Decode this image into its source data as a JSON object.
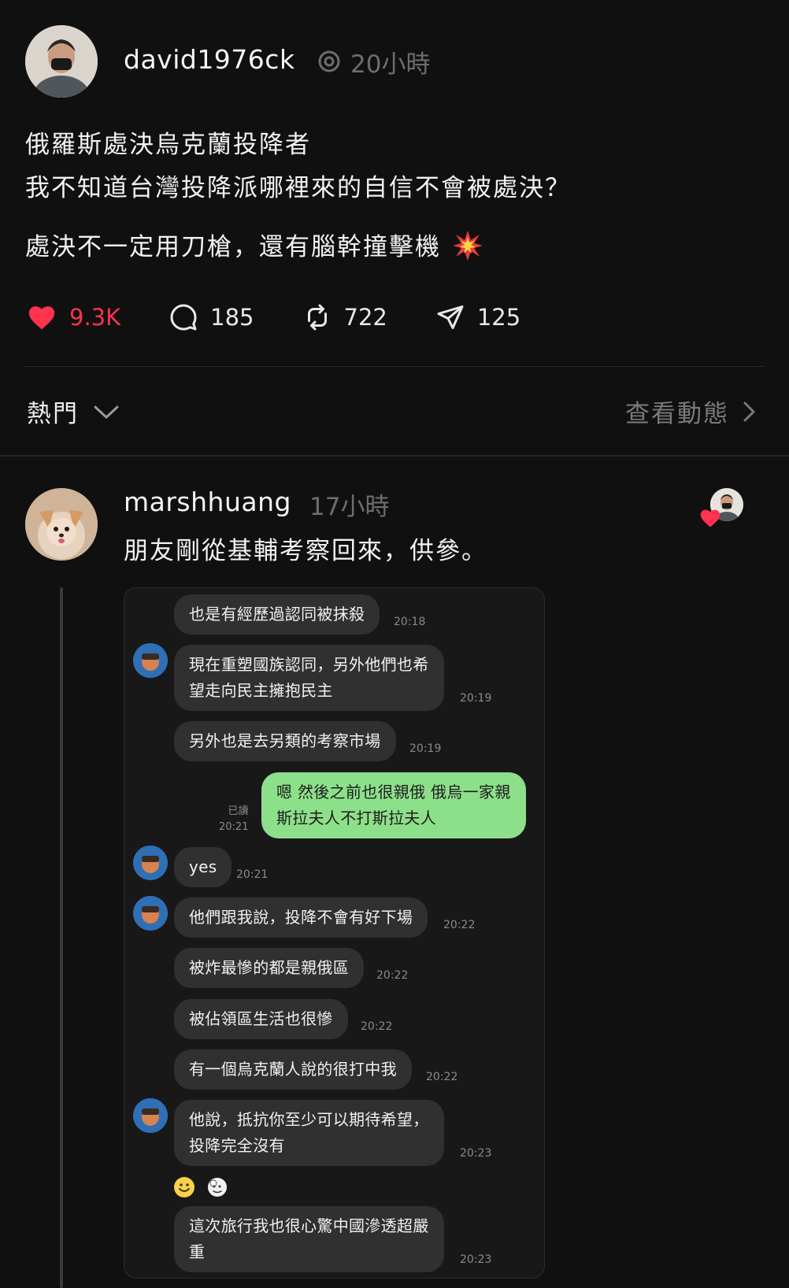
{
  "post": {
    "author": "david1976ck",
    "time": "20小時",
    "lines": [
      "俄羅斯處決烏克蘭投降者",
      "我不知道台灣投降派哪裡來的自信不會被處決？",
      "處決不一定用刀槍，還有腦幹撞擊機"
    ],
    "stats": {
      "likes": "9.3K",
      "comments": "185",
      "reposts": "722",
      "shares": "125"
    }
  },
  "colors": {
    "background": "#101010",
    "like": "#ff3250",
    "my_bubble": "#8de08a",
    "their_bubble": "#303030"
  },
  "sort": {
    "label": "熱門",
    "activity_label": "查看動態"
  },
  "reply": {
    "author": "marshhuang",
    "time": "17小時",
    "text": "朋友剛從基輔考察回來，供參。"
  },
  "chat": {
    "messages": [
      {
        "text": "也是有經歷過認同被抹殺",
        "time": "20:18"
      },
      {
        "text": "現在重塑國族認同，另外他們也希\n望走向民主擁抱民主",
        "time": "20:19"
      },
      {
        "text": "另外也是去另類的考察市場",
        "time": "20:19"
      },
      {
        "text": "嗯 然後之前也很親俄 俄烏一家親\n斯拉夫人不打斯拉夫人",
        "time": "20:21",
        "read": "已讀"
      },
      {
        "text": "yes",
        "time": "20:21"
      },
      {
        "text": "他們跟我說，投降不會有好下場",
        "time": "20:22"
      },
      {
        "text": "被炸最慘的都是親俄區",
        "time": "20:22"
      },
      {
        "text": "被佔領區生活也很慘",
        "time": "20:22"
      },
      {
        "text": "有一個烏克蘭人說的很打中我",
        "time": "20:22"
      },
      {
        "text": "他說，抵抗你至少可以期待希望，\n投降完全沒有",
        "time": "20:23"
      },
      {
        "text": "這次旅行我也很心驚中國滲透超嚴\n重",
        "time": "20:23"
      }
    ],
    "reactions": [
      "smile-emoji",
      "sticker-emoji"
    ]
  }
}
